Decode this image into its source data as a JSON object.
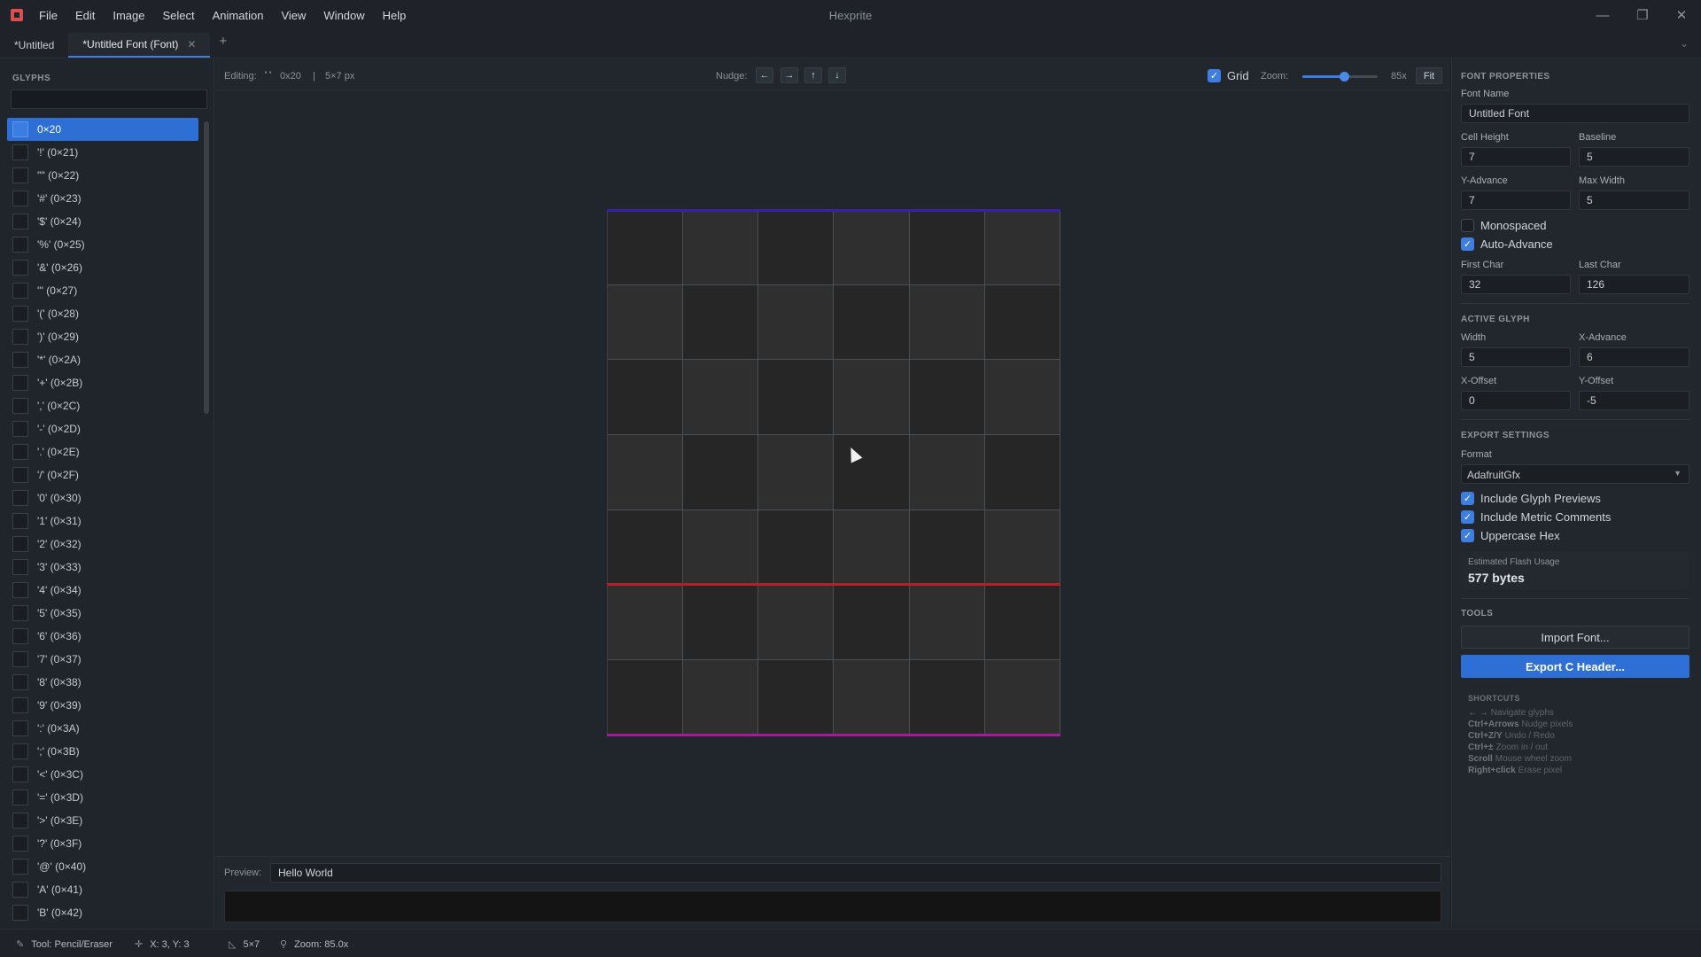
{
  "app": {
    "title": "Hexprite"
  },
  "menu": [
    "File",
    "Edit",
    "Image",
    "Select",
    "Animation",
    "View",
    "Window",
    "Help"
  ],
  "window_controls": {
    "minimize": "—",
    "maximize": "❐",
    "close": "✕"
  },
  "tabs": [
    {
      "label": "*Untitled",
      "active": false
    },
    {
      "label": "*Untitled Font (Font)",
      "active": true,
      "close": "✕"
    }
  ],
  "tab_add": "+",
  "sidebar": {
    "title": "GLYPHS",
    "search_value": "",
    "items": [
      {
        "label": "0×20",
        "selected": true
      },
      {
        "label": "'!' (0×21)"
      },
      {
        "label": "'\"' (0×22)"
      },
      {
        "label": "'#' (0×23)"
      },
      {
        "label": "'$' (0×24)"
      },
      {
        "label": "'%' (0×25)"
      },
      {
        "label": "'&' (0×26)"
      },
      {
        "label": "''' (0×27)"
      },
      {
        "label": "'(' (0×28)"
      },
      {
        "label": "')' (0×29)"
      },
      {
        "label": "'*' (0×2A)"
      },
      {
        "label": "'+' (0×2B)"
      },
      {
        "label": "',' (0×2C)"
      },
      {
        "label": "'-' (0×2D)"
      },
      {
        "label": "'.' (0×2E)"
      },
      {
        "label": "'/' (0×2F)"
      },
      {
        "label": "'0' (0×30)"
      },
      {
        "label": "'1' (0×31)"
      },
      {
        "label": "'2' (0×32)"
      },
      {
        "label": "'3' (0×33)"
      },
      {
        "label": "'4' (0×34)"
      },
      {
        "label": "'5' (0×35)"
      },
      {
        "label": "'6' (0×36)"
      },
      {
        "label": "'7' (0×37)"
      },
      {
        "label": "'8' (0×38)"
      },
      {
        "label": "'9' (0×39)"
      },
      {
        "label": "':' (0×3A)"
      },
      {
        "label": "';' (0×3B)"
      },
      {
        "label": "'<' (0×3C)"
      },
      {
        "label": "'=' (0×3D)"
      },
      {
        "label": "'>' (0×3E)"
      },
      {
        "label": "'?' (0×3F)"
      },
      {
        "label": "'@' (0×40)"
      },
      {
        "label": "'A' (0×41)"
      },
      {
        "label": "'B' (0×42)"
      }
    ]
  },
  "editor_toolbar": {
    "editing_label": "Editing:",
    "editing_char": "' '",
    "editing_code": "0x20",
    "separator": "|",
    "editing_size": "5×7 px",
    "nudge_label": "Nudge:",
    "nudge_buttons": [
      {
        "name": "nudge-left-button",
        "icon": "arrow-left-icon",
        "glyph": "←"
      },
      {
        "name": "nudge-right-button",
        "icon": "arrow-right-icon",
        "glyph": "→"
      },
      {
        "name": "nudge-up-button",
        "icon": "arrow-up-icon",
        "glyph": "↑"
      },
      {
        "name": "nudge-down-button",
        "icon": "arrow-down-icon",
        "glyph": "↓"
      }
    ],
    "grid_checked": true,
    "grid_label": "Grid",
    "zoom_label": "Zoom:",
    "zoom_value": "85x",
    "zoom_fraction": 0.55,
    "fit_label": "Fit"
  },
  "canvas": {
    "columns": 6,
    "rows": 7,
    "colors": {
      "top_guide": "#3a1fa8",
      "baseline_guide": "#b3202a",
      "bottom_guide": "#a8189c"
    }
  },
  "preview": {
    "label": "Preview:",
    "value": "Hello World"
  },
  "properties": {
    "font_title": "FONT PROPERTIES",
    "font_name_label": "Font Name",
    "font_name_value": "Untitled Font",
    "cell_height_label": "Cell Height",
    "cell_height_value": "7",
    "baseline_label": "Baseline",
    "baseline_value": "5",
    "y_advance_label": "Y-Advance",
    "y_advance_value": "7",
    "max_width_label": "Max Width",
    "max_width_value": "5",
    "monospaced_label": "Monospaced",
    "monospaced_checked": false,
    "auto_advance_label": "Auto-Advance",
    "auto_advance_checked": true,
    "first_char_label": "First Char",
    "first_char_value": "32",
    "last_char_label": "Last Char",
    "last_char_value": "126",
    "glyph_title": "ACTIVE GLYPH",
    "width_label": "Width",
    "width_value": "5",
    "x_advance_label": "X-Advance",
    "x_advance_value": "6",
    "x_offset_label": "X-Offset",
    "x_offset_value": "0",
    "y_offset_label": "Y-Offset",
    "y_offset_value": "-5",
    "export_title": "EXPORT SETTINGS",
    "format_label": "Format",
    "format_value": "AdafruitGfx",
    "include_previews_label": "Include Glyph Previews",
    "include_comments_label": "Include Metric Comments",
    "uppercase_hex_label": "Uppercase Hex",
    "flash_label": "Estimated Flash Usage",
    "flash_value": "577 bytes",
    "tools_title": "TOOLS",
    "import_label": "Import Font...",
    "export_label": "Export C Header...",
    "shortcuts_title": "SHORTCUTS",
    "shortcuts": [
      {
        "key": "← →",
        "desc": "Navigate glyphs"
      },
      {
        "key": "Ctrl+Arrows",
        "desc": "Nudge pixels"
      },
      {
        "key": "Ctrl+Z/Y",
        "desc": "Undo / Redo"
      },
      {
        "key": "Ctrl+±",
        "desc": "Zoom in / out"
      },
      {
        "key": "Scroll",
        "desc": "Mouse wheel zoom"
      },
      {
        "key": "Right+click",
        "desc": "Erase pixel"
      }
    ]
  },
  "statusbar": {
    "tool": "Tool: Pencil/Eraser",
    "coords": "X: 3, Y: 3",
    "size": "5×7",
    "zoom": "Zoom: 85.0x"
  },
  "colors": {
    "accent": "#2e6fd6",
    "background": "#21262d"
  }
}
